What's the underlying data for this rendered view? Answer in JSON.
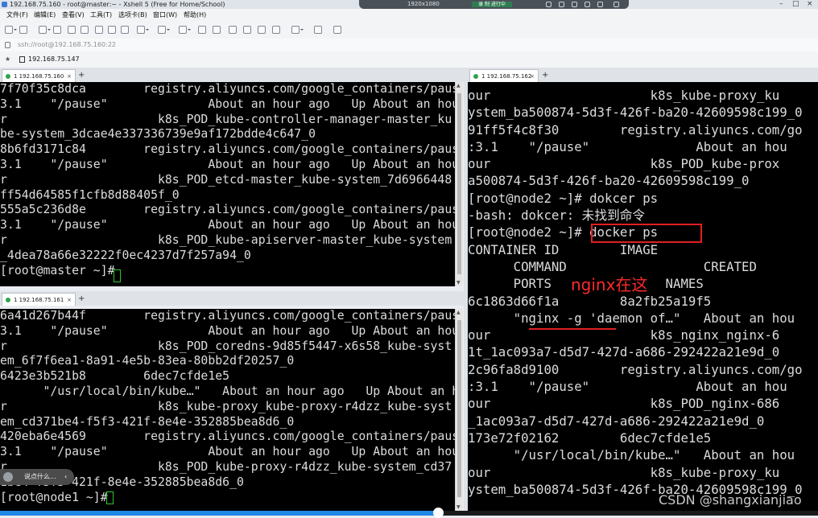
{
  "window": {
    "title": "192.168.75.160 - root@master:~ - Xshell 5 (Free for Home/School)",
    "overlay_resolution": "1920x1080",
    "overlay_chip": "录 制 进行中"
  },
  "menu": [
    "文件(F)",
    "编辑(E)",
    "查看(V)",
    "工具(T)",
    "选项卡(B)",
    "窗口(W)",
    "帮助(H)"
  ],
  "address": {
    "value": "ssh://root@192.168.75.160:22"
  },
  "quick": {
    "host": "192.168.75.147"
  },
  "panes": [
    {
      "tab": "1 192.168.75.160",
      "lines": [
        "7f70f35c8dca        registry.aliyuncs.com/google_containers/pause:",
        "3.1    \"/pause\"              About an hour ago   Up About an hou",
        "r                     k8s_POD_kube-controller-manager-master_ku",
        "be-system_3dcae4e337336739e9af172bdde4c647_0",
        "8b6fd3171c84        registry.aliyuncs.com/google_containers/pause:",
        "3.1    \"/pause\"              About an hour ago   Up About an hou",
        "r                     k8s_POD_etcd-master_kube-system_7d6966448",
        "ff54d64585f1cfb8d88405f_0",
        "555a5c236d8e        registry.aliyuncs.com/google_containers/pause:",
        "3.1    \"/pause\"              About an hour ago   Up About an hou",
        "r                     k8s_POD_kube-apiserver-master_kube-system",
        "_4dea78a66e32222f0ec4237d7f257a94_0",
        "[root@master ~]# "
      ]
    },
    {
      "tab": "1 192.168.75.161",
      "lines": [
        "6a41d267b44f        registry.aliyuncs.com/google_containers/pause:",
        "3.1    \"/pause\"              About an hour ago   Up About an hou",
        "r                     k8s_POD_coredns-9d85f5447-x6s58_kube-syst",
        "em_6f7f6ea1-8a91-4e5b-83ea-80bb2df20257_0",
        "6423e3b521b8        6dec7cfde1e5",
        "      \"/usr/local/bin/kube…\"   About an hour ago   Up About an hou",
        "r                     k8s_kube-proxy_kube-proxy-r4dzz_kube-syst",
        "em_cd371be4-f5f3-421f-8e4e-352885bea8d6_0",
        "420eba6e4569        registry.aliyuncs.com/google_containers/pause:",
        "3.1    \"/pause\"              About an hour ago   Up About an hou",
        "r                     k8s_POD_kube-proxy-r4dzz_kube-system_cd37",
        "1be4-f5f3-421f-8e4e-352885bea8d6_0",
        "[root@node1 ~]# "
      ]
    },
    {
      "tab": "1 192.168.75.162",
      "lines": [
        "our                     k8s_kube-proxy_ku",
        "ystem_ba500874-5d3f-426f-ba20-42609598c199_0",
        "91ff5f4c8f30        registry.aliyuncs.com/go",
        ":3.1    \"/pause\"              About an hou",
        "our                     k8s_POD_kube-prox",
        "a500874-5d3f-426f-ba20-42609598c199_0",
        "[root@node2 ~]# dokcer ps",
        "-bash: dokcer: 未找到命令",
        "[root@node2 ~]# docker ps",
        "CONTAINER ID        IMAGE",
        "      COMMAND                  CREATED",
        "      PORTS               NAMES",
        "6c1863d66f1a        8a2fb25a19f5",
        "      \"nginx -g 'daemon of…\"   About an hou",
        "our                     k8s_nginx_nginx-6",
        "1t_1ac093a7-d5d7-427d-a686-292422a21e9d_0",
        "2c96fa8d9100        registry.aliyuncs.com/go",
        ":3.1    \"/pause\"              About an hou",
        "our                     k8s_POD_nginx-686",
        "_1ac093a7-d5d7-427d-a686-292422a21e9d_0",
        "173e72f02162        6dec7cfde1e5",
        "      \"/usr/local/bin/kube…\"   About an hou",
        "our                     k8s_kube-proxy_ku",
        "ystem_ba500874-5d3f-426f-ba20-42609598c199_0"
      ]
    }
  ],
  "annotation": {
    "text": "nginx在这",
    "color": "#e02020"
  },
  "toast": {
    "text": "说点什么..."
  },
  "watermark": "CSDN @shangxianjiao",
  "video_progress": 0.535
}
